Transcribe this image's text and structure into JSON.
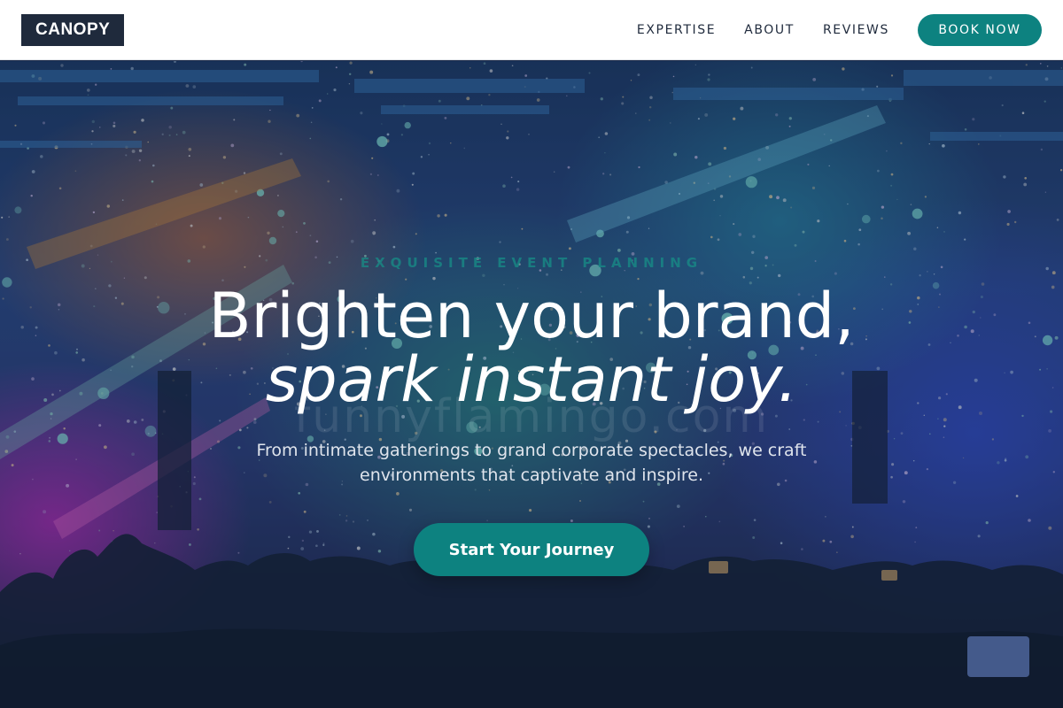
{
  "brand": {
    "logo_text": "CANOPY"
  },
  "nav": {
    "links": [
      {
        "label": "EXPERTISE"
      },
      {
        "label": "ABOUT"
      },
      {
        "label": "REVIEWS"
      }
    ],
    "cta_label": "BOOK NOW"
  },
  "hero": {
    "eyebrow": "EXQUISITE EVENT PLANNING",
    "headline_line1": "Brighten your brand,",
    "headline_line2": "spark instant joy.",
    "watermark": "funnyflamingo.com",
    "subtitle": "From intimate gatherings to grand corporate spectacles, we craft environments that captivate and inspire.",
    "cta_label": "Start Your Journey",
    "background_description_icon": "concert-crowd-image"
  },
  "colors": {
    "accent": "#0d8280",
    "logo_bg": "#1f2a3c",
    "nav_text": "#1f2a3c",
    "nav_bg": "#ffffff"
  }
}
